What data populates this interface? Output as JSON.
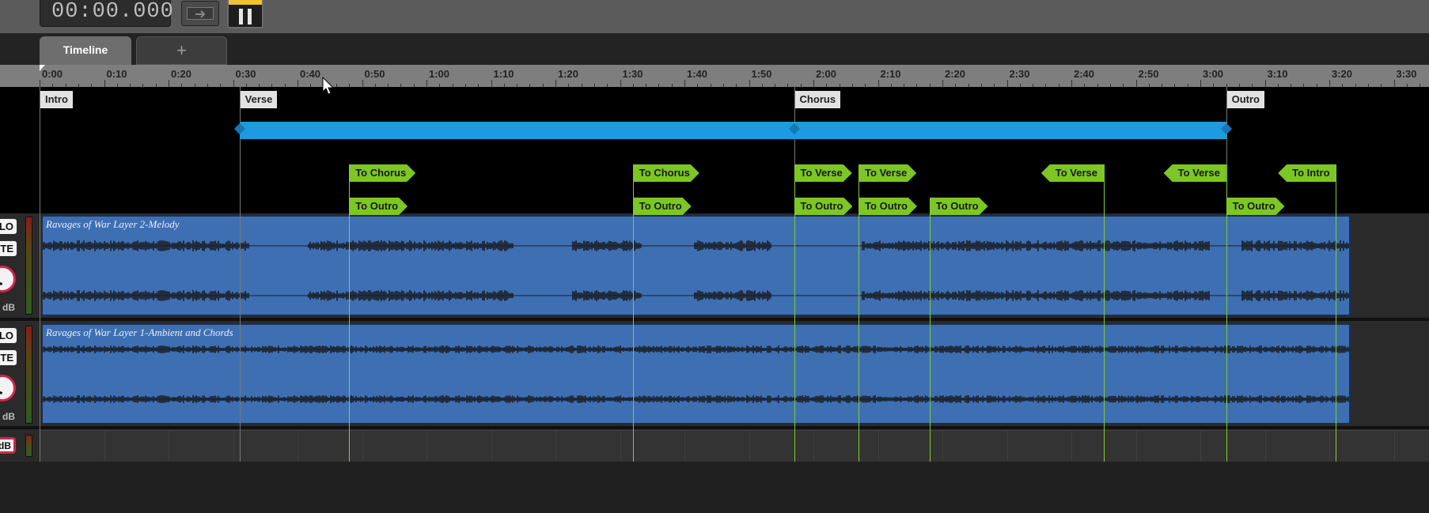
{
  "transport": {
    "time": "00:00.000",
    "accent_color": "#f1c232"
  },
  "tabs": [
    {
      "label": "Timeline",
      "active": true
    },
    {
      "label": "+",
      "active": false
    }
  ],
  "ruler": {
    "ticks": [
      "0:00",
      "0:10",
      "0:20",
      "0:30",
      "0:40",
      "0:50",
      "1:00",
      "1:10",
      "1:20",
      "1:30",
      "1:40",
      "1:50",
      "2:00",
      "2:10",
      "2:20",
      "2:30",
      "2:40",
      "2:50",
      "3:00",
      "3:10",
      "3:20",
      "3:30"
    ]
  },
  "sections": [
    {
      "label": "Intro",
      "time": "0:00"
    },
    {
      "label": "Verse",
      "time": "0:31"
    },
    {
      "label": "Chorus",
      "time": "1:57"
    },
    {
      "label": "Outro",
      "time": "3:04"
    }
  ],
  "loop": {
    "color": "#1e9ae0",
    "start": "0:31",
    "mid": "1:57",
    "end": "3:04"
  },
  "jumps": [
    {
      "label": "To Chorus",
      "time": "0:48",
      "dir": "right",
      "row": 1
    },
    {
      "label": "To Outro",
      "time": "0:48",
      "dir": "right",
      "row": 2
    },
    {
      "label": "To Chorus",
      "time": "1:32",
      "dir": "right",
      "row": 1
    },
    {
      "label": "To Outro",
      "time": "1:32",
      "dir": "right",
      "row": 2
    },
    {
      "label": "To Verse",
      "time": "1:57",
      "dir": "right",
      "row": 1
    },
    {
      "label": "To Outro",
      "time": "1:57",
      "dir": "right",
      "row": 2
    },
    {
      "label": "To Verse",
      "time": "2:07",
      "dir": "right",
      "row": 1
    },
    {
      "label": "To Outro",
      "time": "2:07",
      "dir": "right",
      "row": 2
    },
    {
      "label": "To Outro",
      "time": "2:18",
      "dir": "right",
      "row": 2
    },
    {
      "label": "To Verse",
      "time": "2:45",
      "dir": "left",
      "row": 1
    },
    {
      "label": "To Verse",
      "time": "3:04",
      "dir": "left",
      "row": 1
    },
    {
      "label": "To Outro",
      "time": "3:04",
      "dir": "right",
      "row": 2
    },
    {
      "label": "To Intro",
      "time": "3:21",
      "dir": "left",
      "row": 1
    }
  ],
  "tracks": [
    {
      "name": "Ravages of War Layer 2-Melody",
      "solo_label": "LO",
      "mute_label": "UTE",
      "db_label": "dB"
    },
    {
      "name": "Ravages of War Layer 1-Ambient and Chords",
      "solo_label": "LO",
      "mute_label": "UTE",
      "db_label": "dB"
    }
  ],
  "master": {
    "db_label": "dB"
  },
  "colors": {
    "clip": "#3e6fb3",
    "marker": "#7cc626",
    "loop": "#1e9ae0",
    "knob_ring": "#d02650"
  }
}
